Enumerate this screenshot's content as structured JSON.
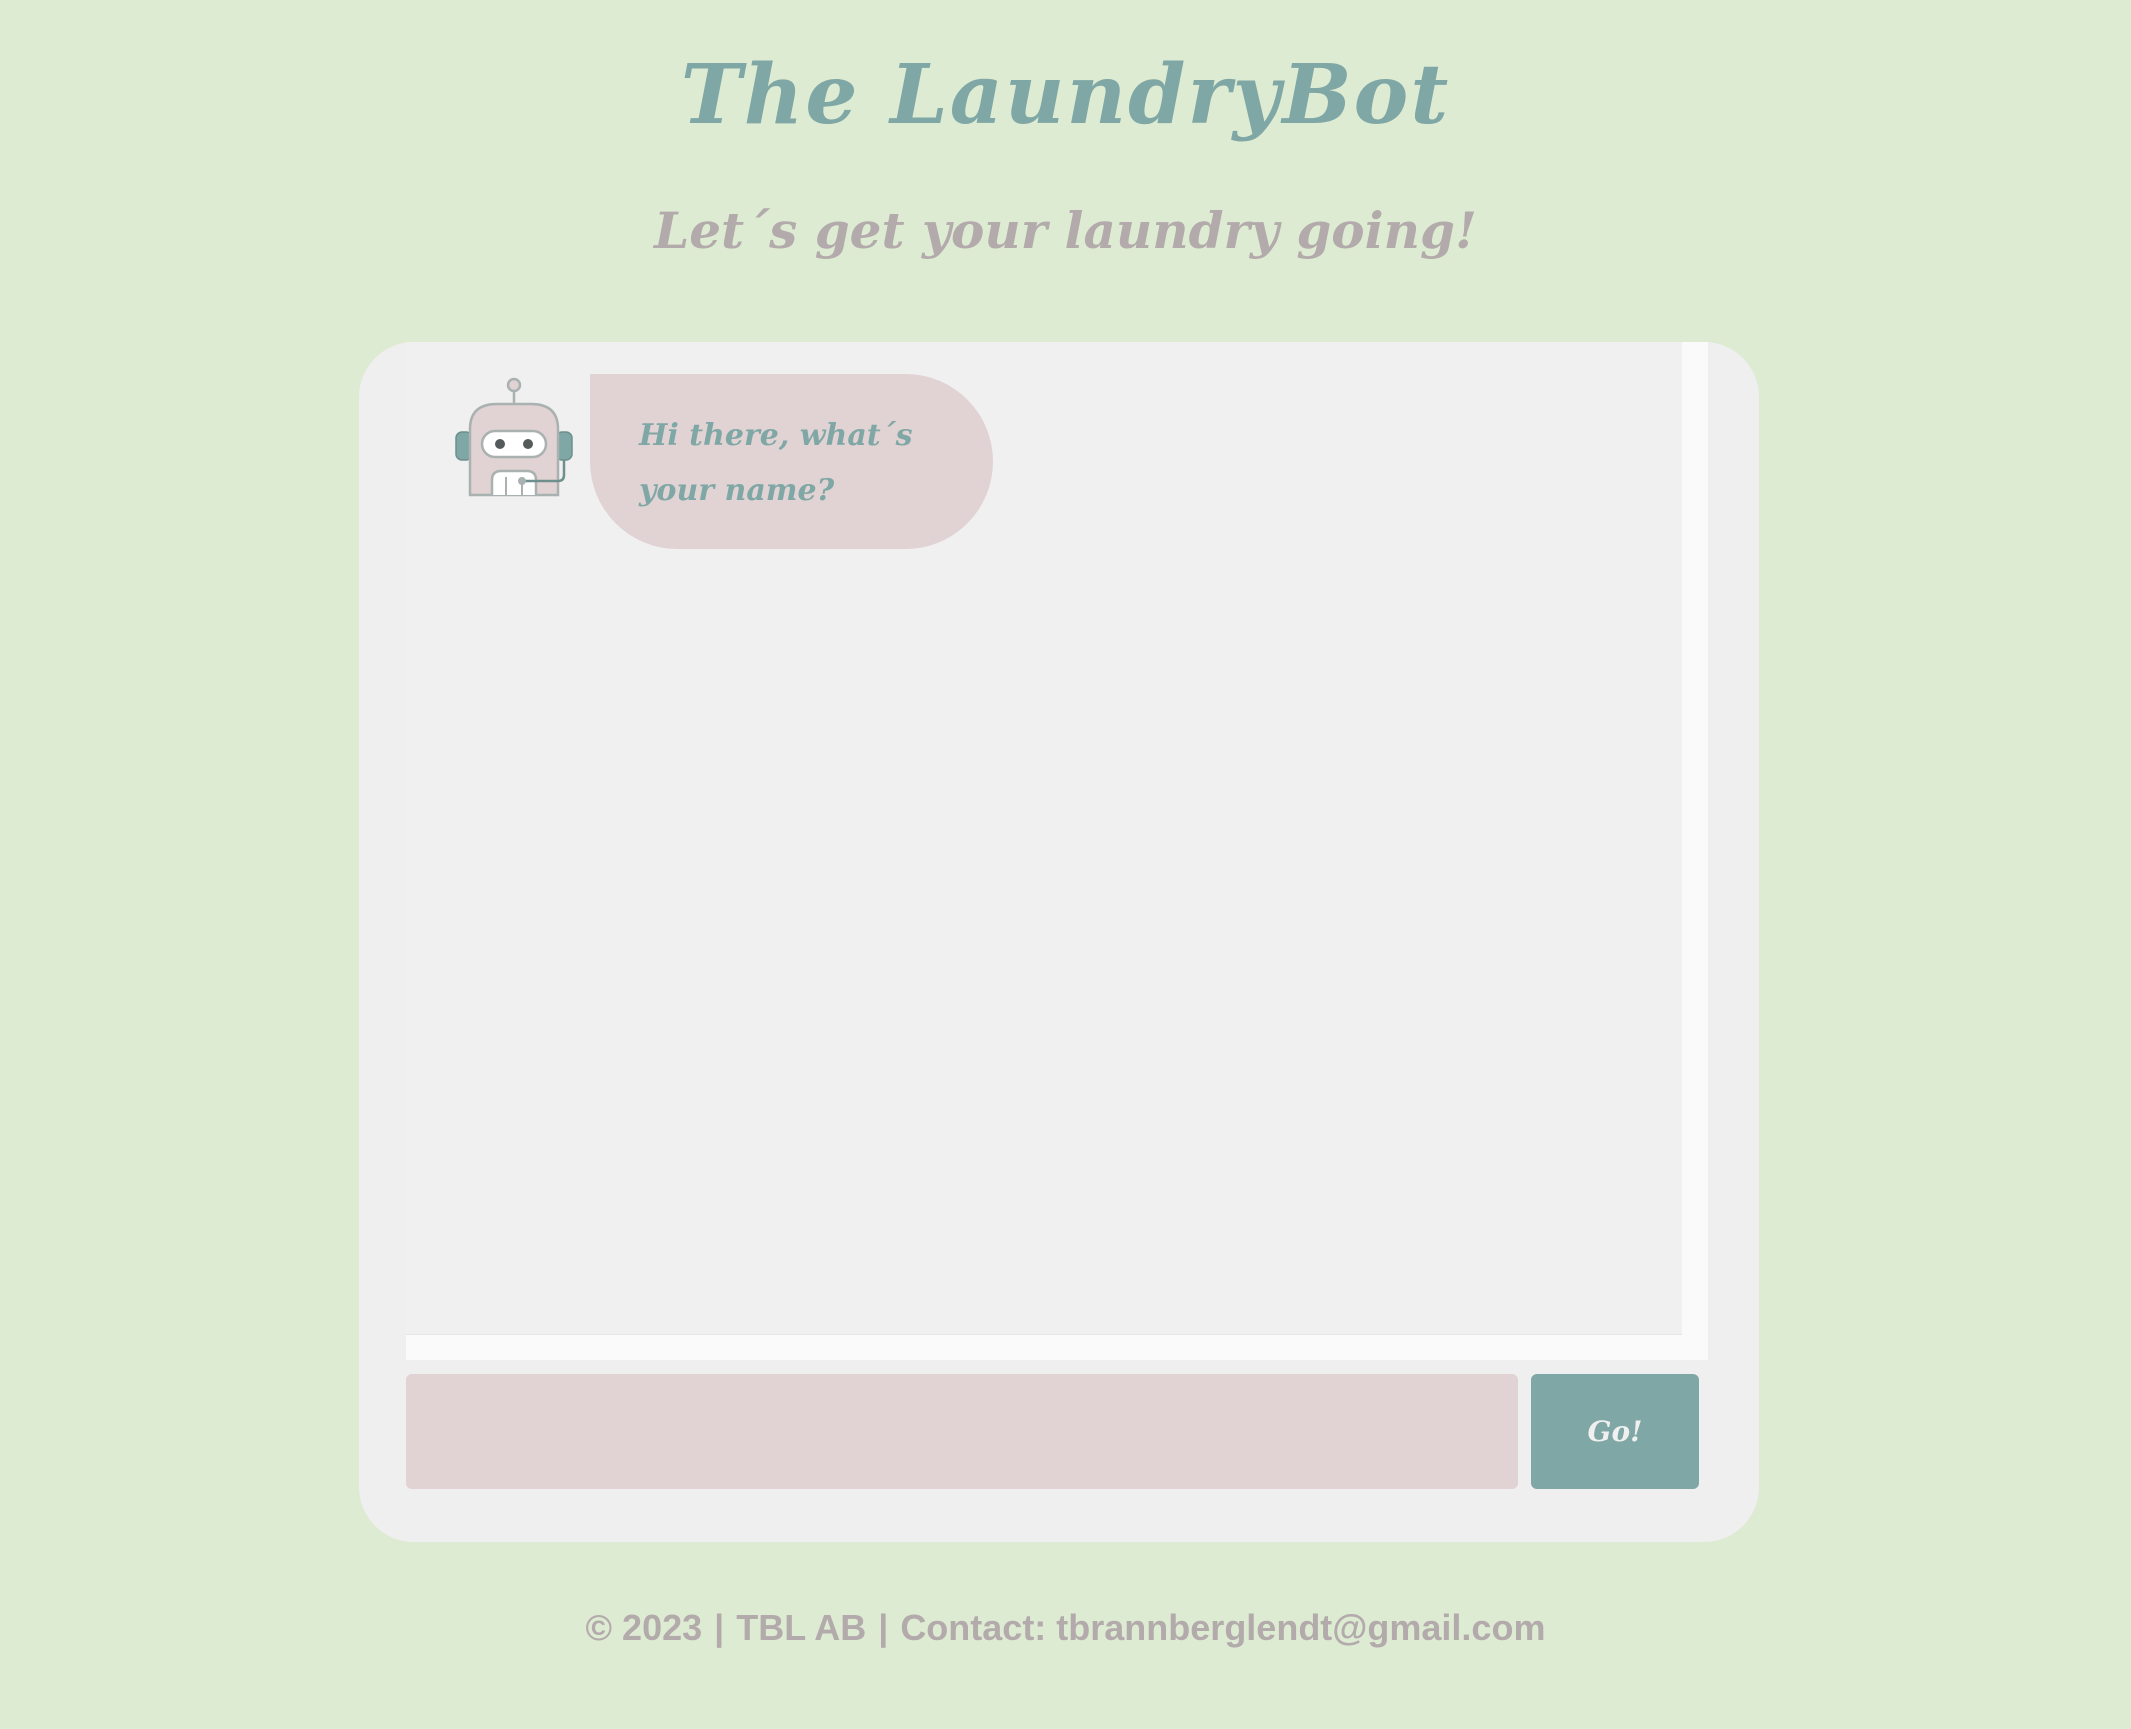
{
  "header": {
    "title": "The LaundryBot",
    "subtitle": "Let´s get your laundry going!"
  },
  "chat": {
    "messages": [
      {
        "sender": "bot",
        "avatar_icon": "robot-icon",
        "text": "Hi there, what´s your name?"
      }
    ],
    "input": {
      "value": "",
      "placeholder": ""
    },
    "send_button_label": "Go!"
  },
  "footer": {
    "copyright": "© 2023",
    "company": "TBL AB",
    "contact": "Contact: tbrannberglendt@gmail.com",
    "separator": "|"
  },
  "colors": {
    "background": "#deebd3",
    "accent": "#7fa7a5",
    "bubble": "#e1d2d3",
    "muted_text": "#b3aaab",
    "card": "#efefef"
  }
}
